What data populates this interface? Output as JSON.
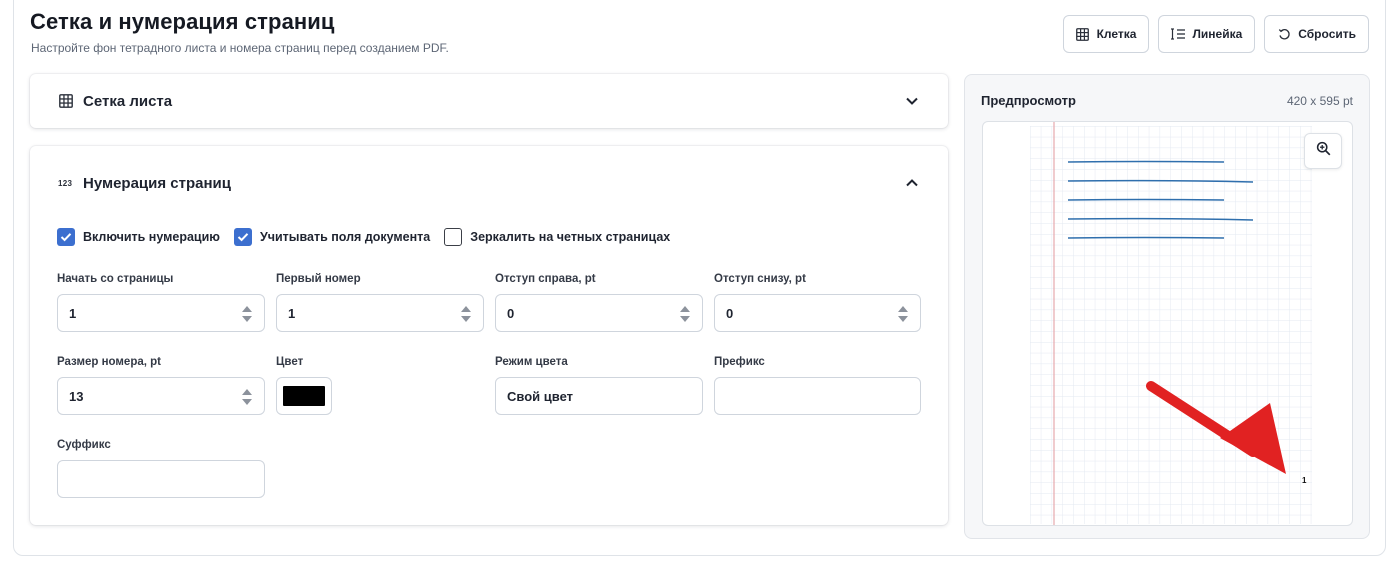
{
  "header": {
    "title": "Сетка и нумерация страниц",
    "subtitle": "Настройте фон тетрадного листа и номера страниц перед созданием PDF."
  },
  "toolbar": [
    {
      "label": "Клетка",
      "icon": "grid-icon"
    },
    {
      "label": "Линейка",
      "icon": "lines-icon"
    },
    {
      "label": "Сбросить",
      "icon": "reset-icon"
    }
  ],
  "grid_panel": {
    "title": "Сетка листа",
    "icon": "grid-icon",
    "expanded": false
  },
  "numbering_panel": {
    "title": "Нумерация страниц",
    "icon_text": "123",
    "expanded": true,
    "checkboxes": [
      {
        "label": "Включить нумерацию",
        "checked": true
      },
      {
        "label": "Учитывать поля документа",
        "checked": true
      },
      {
        "label": "Зеркалить на четных страницах",
        "checked": false
      }
    ],
    "fields": {
      "start_page": {
        "label": "Начать со страницы",
        "value": "1"
      },
      "first_number": {
        "label": "Первый номер",
        "value": "1"
      },
      "offset_right": {
        "label": "Отступ справа, pt",
        "value": "0"
      },
      "offset_bottom": {
        "label": "Отступ снизу, pt",
        "value": "0"
      },
      "number_size": {
        "label": "Размер номера, pt",
        "value": "13"
      },
      "color": {
        "label": "Цвет",
        "value": "#000000"
      },
      "color_mode": {
        "label": "Режим цвета",
        "value": "Свой цвет"
      },
      "prefix": {
        "label": "Префикс",
        "value": ""
      },
      "suffix": {
        "label": "Суффикс",
        "value": ""
      }
    }
  },
  "preview": {
    "title": "Предпросмотр",
    "size": "420 x 595 pt",
    "page_number": "1",
    "colors": {
      "grid": "#e3e9f1",
      "margin_line": "#e7a9ad",
      "text_lines": "#2f6fad",
      "arrow": "#e12222"
    }
  }
}
